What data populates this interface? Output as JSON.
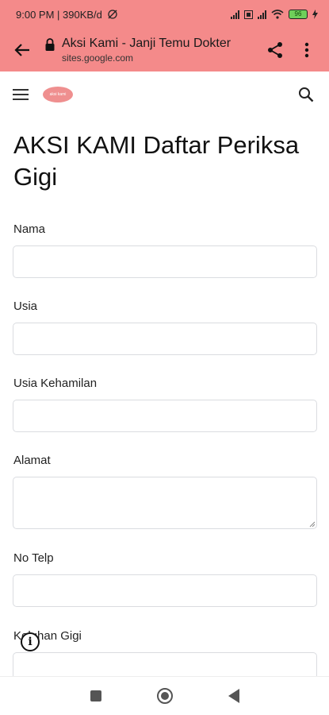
{
  "status_bar": {
    "time_speed": "9:00 PM | 390KB/d",
    "battery": "96"
  },
  "browser": {
    "page_title": "Aksi Kami - Janji Temu Dokter",
    "url": "sites.google.com"
  },
  "site": {
    "logo_text": "aksi kami"
  },
  "page": {
    "heading": "AKSI KAMI Daftar Periksa Gigi"
  },
  "form": {
    "fields": [
      {
        "label": "Nama",
        "value": ""
      },
      {
        "label": "Usia",
        "value": ""
      },
      {
        "label": "Usia Kehamilan",
        "value": ""
      },
      {
        "label": "Alamat",
        "value": ""
      },
      {
        "label": "No Telp",
        "value": ""
      },
      {
        "label": "Keluhan Gigi",
        "value": ""
      }
    ]
  },
  "overlay": {
    "info_icon": "i"
  },
  "colors": {
    "toolbar": "#f48a8a",
    "input_border": "#dadce0"
  }
}
